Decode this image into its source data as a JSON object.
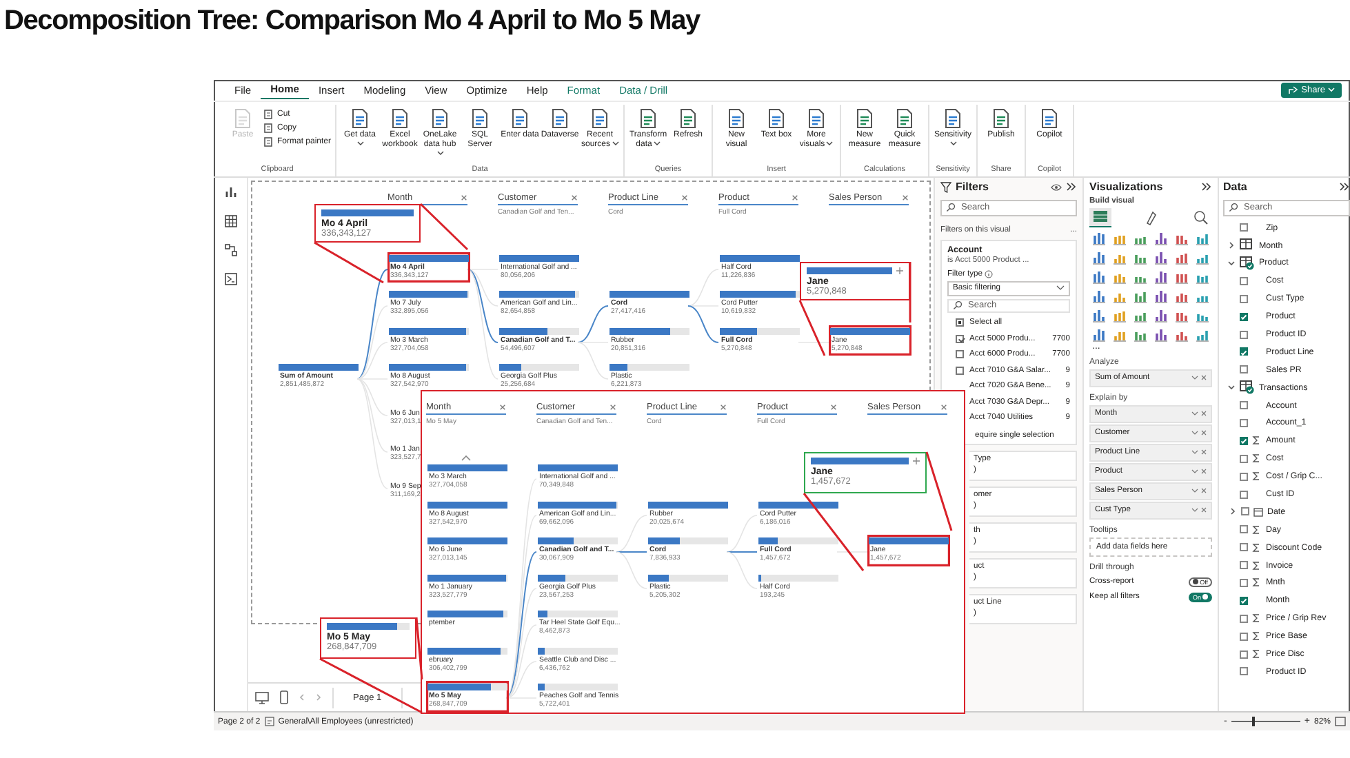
{
  "page_title": "Decomposition Tree: Comparison Mo 4 April to Mo 5 May",
  "menu_tabs": [
    {
      "label": "File",
      "selected": false,
      "kind": "plain"
    },
    {
      "label": "Home",
      "selected": true,
      "kind": "plain"
    },
    {
      "label": "Insert",
      "selected": false,
      "kind": "plain"
    },
    {
      "label": "Modeling",
      "selected": false,
      "kind": "plain"
    },
    {
      "label": "View",
      "selected": false,
      "kind": "plain"
    },
    {
      "label": "Optimize",
      "selected": false,
      "kind": "plain"
    },
    {
      "label": "Help",
      "selected": false,
      "kind": "plain"
    },
    {
      "label": "Format",
      "selected": false,
      "kind": "contextual"
    },
    {
      "label": "Data / Drill",
      "selected": false,
      "kind": "contextual"
    }
  ],
  "share_button": "Share",
  "ribbon_groups": [
    {
      "name": "Clipboard",
      "buttons": [
        {
          "label": "Paste",
          "kind": "large",
          "disabled": true,
          "dropdown": false
        },
        {
          "label": "Cut",
          "kind": "small",
          "disabled": false,
          "dropdown": false
        },
        {
          "label": "Copy",
          "kind": "small",
          "disabled": false,
          "dropdown": false
        },
        {
          "label": "Format painter",
          "kind": "small",
          "disabled": false,
          "dropdown": false
        }
      ]
    },
    {
      "name": "Data",
      "buttons": [
        {
          "label": "Get data",
          "kind": "large",
          "disabled": false,
          "dropdown": true
        },
        {
          "label": "Excel workbook",
          "kind": "large",
          "disabled": false,
          "dropdown": false
        },
        {
          "label": "OneLake data hub",
          "kind": "large",
          "disabled": false,
          "dropdown": true
        },
        {
          "label": "SQL Server",
          "kind": "large",
          "disabled": false,
          "dropdown": false
        },
        {
          "label": "Enter data",
          "kind": "large",
          "disabled": false,
          "dropdown": false
        },
        {
          "label": "Dataverse",
          "kind": "large",
          "disabled": false,
          "dropdown": false
        },
        {
          "label": "Recent sources",
          "kind": "large",
          "disabled": false,
          "dropdown": true
        }
      ]
    },
    {
      "name": "Queries",
      "buttons": [
        {
          "label": "Transform data",
          "kind": "large",
          "disabled": false,
          "dropdown": true
        },
        {
          "label": "Refresh",
          "kind": "large",
          "disabled": false,
          "dropdown": false
        }
      ]
    },
    {
      "name": "Insert",
      "buttons": [
        {
          "label": "New visual",
          "kind": "large",
          "disabled": false,
          "dropdown": false
        },
        {
          "label": "Text box",
          "kind": "large",
          "disabled": false,
          "dropdown": false
        },
        {
          "label": "More visuals",
          "kind": "large",
          "disabled": false,
          "dropdown": true
        }
      ]
    },
    {
      "name": "Calculations",
      "buttons": [
        {
          "label": "New measure",
          "kind": "large",
          "disabled": false,
          "dropdown": false
        },
        {
          "label": "Quick measure",
          "kind": "large",
          "disabled": false,
          "dropdown": false
        }
      ]
    },
    {
      "name": "Sensitivity",
      "buttons": [
        {
          "label": "Sensitivity",
          "kind": "large",
          "disabled": false,
          "dropdown": true
        }
      ]
    },
    {
      "name": "Share",
      "buttons": [
        {
          "label": "Publish",
          "kind": "large",
          "disabled": false,
          "dropdown": false
        }
      ]
    },
    {
      "name": "Copilot",
      "buttons": [
        {
          "label": "Copilot",
          "kind": "large",
          "disabled": false,
          "dropdown": false
        }
      ]
    }
  ],
  "canvas": {
    "tree": {
      "root": {
        "label": "Sum of Amount",
        "value": "2,851,485,872",
        "level": 1
      },
      "columns": [
        {
          "header": "Month",
          "nodes": [
            {
              "label": "Mo 4 April",
              "value": "336,343,127",
              "level": 1,
              "selected": true,
              "boxed": true
            },
            {
              "label": "Mo 7 July",
              "value": "332,895,056",
              "level": 0.99,
              "selected": false,
              "boxed": false
            },
            {
              "label": "Mo 3 March",
              "value": "327,704,058",
              "level": 0.97,
              "selected": false,
              "boxed": false
            },
            {
              "label": "Mo 8 August",
              "value": "327,542,970",
              "level": 0.97,
              "selected": false,
              "boxed": false
            },
            {
              "label": "Mo 6 Jun",
              "value": "327,013,1",
              "selected": false,
              "boxed": false
            },
            {
              "label": "Mo 1 Jan",
              "value": "323,527,7",
              "selected": false,
              "boxed": false
            },
            {
              "label": "Mo 9 Sep",
              "value": "311,169,2",
              "selected": false,
              "boxed": false
            }
          ]
        },
        {
          "header": "Customer",
          "subtitle": "Canadian Golf and Ten...",
          "nodes": [
            {
              "label": "International Golf and ...",
              "value": "80,056,206",
              "level": 1,
              "selected": false,
              "boxed": false
            },
            {
              "label": "American Golf and Lin...",
              "value": "82,654,858",
              "level": 0.95,
              "selected": false,
              "boxed": false
            },
            {
              "label": "Canadian Golf and T...",
              "value": "54,496,607",
              "level": 0.6,
              "selected": true,
              "boxed": false
            },
            {
              "label": "Georgia Golf Plus",
              "value": "25,256,684",
              "level": 0.28,
              "selected": false,
              "boxed": false
            }
          ]
        },
        {
          "header": "Product Line",
          "subtitle": "Cord",
          "nodes": [
            {
              "label": "Cord",
              "value": "27,417,416",
              "level": 1,
              "selected": true,
              "boxed": false
            },
            {
              "label": "Rubber",
              "value": "20,851,316",
              "level": 0.76,
              "selected": false,
              "boxed": false
            },
            {
              "label": "Plastic",
              "value": "6,221,873",
              "level": 0.23,
              "selected": false,
              "boxed": false
            }
          ]
        },
        {
          "header": "Product",
          "subtitle": "Full Cord",
          "nodes": [
            {
              "label": "Half Cord",
              "value": "11,226,836",
              "level": 1,
              "selected": false,
              "boxed": false
            },
            {
              "label": "Cord Putter",
              "value": "10,619,832",
              "level": 0.95,
              "selected": false,
              "boxed": false
            },
            {
              "label": "Full Cord",
              "value": "5,270,848",
              "level": 0.47,
              "selected": true,
              "boxed": false
            }
          ]
        },
        {
          "header": "Sales Person",
          "nodes": [
            {
              "label": "Jane",
              "value": "5,270,848",
              "level": 1,
              "selected": false,
              "boxed": true
            }
          ]
        }
      ]
    },
    "inset": {
      "tree": {
        "columns": [
          {
            "header": "Month",
            "subtitle": "Mo 5 May",
            "more_above": true,
            "nodes": [
              {
                "label": "Mo 3 March",
                "value": "327,704,058",
                "level": 1,
                "selected": false,
                "boxed": false
              },
              {
                "label": "Mo 8 August",
                "value": "327,542,970",
                "level": 1,
                "selected": false,
                "boxed": false
              },
              {
                "label": "Mo 6 June",
                "value": "327,013,145",
                "level": 1,
                "selected": false,
                "boxed": false
              },
              {
                "label": "Mo 1 January",
                "value": "323,527,779",
                "level": 0.98,
                "selected": false,
                "boxed": false
              },
              {
                "label": "ptember",
                "level": 0.95,
                "selected": false,
                "boxed": false
              },
              {
                "label": "ebruary",
                "value": "306,402,799",
                "level": 0.92,
                "selected": false,
                "boxed": false
              },
              {
                "label": "Mo 5 May",
                "value": "268,847,709",
                "level": 0.8,
                "selected": true,
                "boxed": true
              }
            ]
          },
          {
            "header": "Customer",
            "subtitle": "Canadian Golf and Ten...",
            "nodes": [
              {
                "label": "International Golf and ...",
                "value": "70,349,848",
                "level": 1,
                "selected": false,
                "boxed": false
              },
              {
                "label": "American Golf and Lin...",
                "value": "69,662,096",
                "level": 0.99,
                "selected": false,
                "boxed": false
              },
              {
                "label": "Canadian Golf and T...",
                "value": "30,067,909",
                "level": 0.45,
                "selected": true,
                "boxed": false
              },
              {
                "label": "Georgia Golf Plus",
                "value": "23,567,253",
                "level": 0.35,
                "selected": false,
                "boxed": false
              },
              {
                "label": "Tar Heel State Golf Equ...",
                "value": "8,462,873",
                "level": 0.12,
                "selected": false,
                "boxed": false
              },
              {
                "label": "Seattle Club and Disc ...",
                "value": "6,436,762",
                "level": 0.09,
                "selected": false,
                "boxed": false
              },
              {
                "label": "Peaches Golf and Tennis",
                "value": "5,722,401",
                "level": 0.08,
                "selected": false,
                "boxed": false
              }
            ]
          },
          {
            "header": "Product Line",
            "subtitle": "Cord",
            "nodes": [
              {
                "label": "Rubber",
                "value": "20,025,674",
                "level": 1,
                "selected": false,
                "boxed": false
              },
              {
                "label": "Cord",
                "value": "7,836,933",
                "level": 0.39,
                "selected": true,
                "boxed": false
              },
              {
                "label": "Plastic",
                "value": "5,205,302",
                "level": 0.26,
                "selected": false,
                "boxed": false
              }
            ]
          },
          {
            "header": "Product",
            "subtitle": "Full Cord",
            "nodes": [
              {
                "label": "Cord Putter",
                "value": "6,186,016",
                "level": 1,
                "selected": false,
                "boxed": false
              },
              {
                "label": "Full Cord",
                "value": "1,457,672",
                "level": 0.24,
                "selected": true,
                "boxed": false
              },
              {
                "label": "Half Cord",
                "value": "193,245",
                "level": 0.03,
                "selected": false,
                "boxed": false
              }
            ]
          },
          {
            "header": "Sales Person",
            "nodes": [
              {
                "label": "Jane",
                "value": "1,457,672",
                "level": 1,
                "selected": false,
                "boxed": true
              }
            ]
          }
        ]
      }
    },
    "callouts": [
      {
        "label": "Mo 4 April",
        "value": "336,343,127",
        "level": 1,
        "color": "#d9222a",
        "plus": false
      },
      {
        "label": "Jane",
        "value": "5,270,848",
        "level": 1,
        "color": "#d9222a",
        "plus": true
      },
      {
        "label": "Jane",
        "value": "1,457,672",
        "level": 1,
        "color": "#2fa84f",
        "plus": true
      },
      {
        "label": "Mo 5 May",
        "value": "268,847,709",
        "level": 0.85,
        "color": "#d9222a",
        "plus": false
      }
    ],
    "pages": [
      {
        "label": "Page 1",
        "selected": false
      }
    ]
  },
  "filters": {
    "title": "Filters",
    "search_placeholder": "Search",
    "section": "Filters on this visual",
    "more": "...",
    "card": {
      "title": "Account",
      "summary": "is Acct 5000 Product ...",
      "filter_type_label": "Filter type",
      "filter_type": "Basic filtering",
      "search_placeholder": "Search",
      "options": [
        {
          "label": "Select all",
          "checked": false,
          "indeterminate": true
        },
        {
          "label": "Acct 5000 Produ...",
          "count": "7700",
          "checked": true,
          "indeterminate": false
        },
        {
          "label": "Acct 6000 Produ...",
          "count": "7700",
          "checked": false,
          "indeterminate": false
        },
        {
          "label": "Acct 7010 G&A Salar...",
          "count": "9",
          "checked": false,
          "indeterminate": false
        },
        {
          "label": "Acct 7020 G&A Bene...",
          "count": "9"
        },
        {
          "label": "Acct 7030 G&A Depr...",
          "count": "9"
        },
        {
          "label": "Acct 7040 Utilities",
          "count": "9"
        }
      ],
      "require_single": "equire single selection"
    },
    "other_cards": [
      {
        "title": "Type",
        "value": ")"
      },
      {
        "title": "omer",
        "value": ")"
      },
      {
        "title": "th",
        "value": ")"
      },
      {
        "title": "uct",
        "value": ")"
      },
      {
        "title": "uct Line",
        "value": ")"
      }
    ]
  },
  "visualizations": {
    "title": "Visualizations",
    "build_visual": "Build visual",
    "build_tabs": [
      {
        "selected": true
      },
      {
        "selected": false
      },
      {
        "selected": false
      }
    ],
    "more": "...",
    "analyze": {
      "label": "Analyze",
      "fields": [
        "Sum of Amount"
      ]
    },
    "explain_by": {
      "label": "Explain by",
      "fields": [
        "Month",
        "Customer",
        "Product Line",
        "Product",
        "Sales Person",
        "Cust Type"
      ]
    },
    "tooltips": {
      "label": "Tooltips",
      "placeholder": "Add data fields here"
    },
    "drill_through": {
      "label": "Drill through",
      "toggles": [
        {
          "label": "Cross-report",
          "on": false,
          "state_text": "Off"
        },
        {
          "label": "Keep all filters",
          "on": true,
          "state_text": "On"
        }
      ]
    }
  },
  "data": {
    "title": "Data",
    "search_placeholder": "Search",
    "items": [
      {
        "label": "Zip",
        "kind": "field",
        "checked": false
      },
      {
        "label": "Month",
        "kind": "table",
        "expanded": false
      },
      {
        "label": "Product",
        "kind": "table",
        "expanded": true,
        "children": [
          {
            "label": "Cost",
            "kind": "field",
            "checked": false
          },
          {
            "label": "Cust Type",
            "kind": "field",
            "checked": false
          },
          {
            "label": "Product",
            "kind": "field",
            "checked": true
          },
          {
            "label": "Product ID",
            "kind": "field",
            "checked": false
          },
          {
            "label": "Product Line",
            "kind": "field",
            "checked": true
          },
          {
            "label": "Sales PR",
            "kind": "field",
            "checked": false
          }
        ]
      },
      {
        "label": "Transactions",
        "kind": "table",
        "expanded": true,
        "children": [
          {
            "label": "Account",
            "kind": "field",
            "checked": false
          },
          {
            "label": "Account_1",
            "kind": "field",
            "checked": false
          },
          {
            "label": "Amount",
            "kind": "measure",
            "checked": true
          },
          {
            "label": "Cost",
            "kind": "measure",
            "checked": false
          },
          {
            "label": "Cost / Grip C...",
            "kind": "measure",
            "checked": false
          },
          {
            "label": "Cust ID",
            "kind": "field",
            "checked": false
          },
          {
            "label": "Date",
            "kind": "hierarchy",
            "checked": false,
            "expanded": false
          },
          {
            "label": "Day",
            "kind": "measure",
            "checked": false
          },
          {
            "label": "Discount Code",
            "kind": "measure",
            "checked": false
          },
          {
            "label": "Invoice",
            "kind": "measure",
            "checked": false
          },
          {
            "label": "Mnth",
            "kind": "measure",
            "checked": false
          },
          {
            "label": "Month",
            "kind": "field",
            "checked": true
          },
          {
            "label": "Price / Grip Rev",
            "kind": "measure",
            "checked": false
          },
          {
            "label": "Price Base",
            "kind": "measure",
            "checked": false
          },
          {
            "label": "Price Disc",
            "kind": "measure",
            "checked": false
          },
          {
            "label": "Product ID",
            "kind": "field",
            "checked": false
          }
        ]
      }
    ]
  },
  "status": {
    "page_info": "Page 2 of 2",
    "sensitivity": "General\\All Employees (unrestricted)",
    "zoom": {
      "zoom_out": "-",
      "zoom_in": "+",
      "label": "82%",
      "level": 0.3
    }
  }
}
